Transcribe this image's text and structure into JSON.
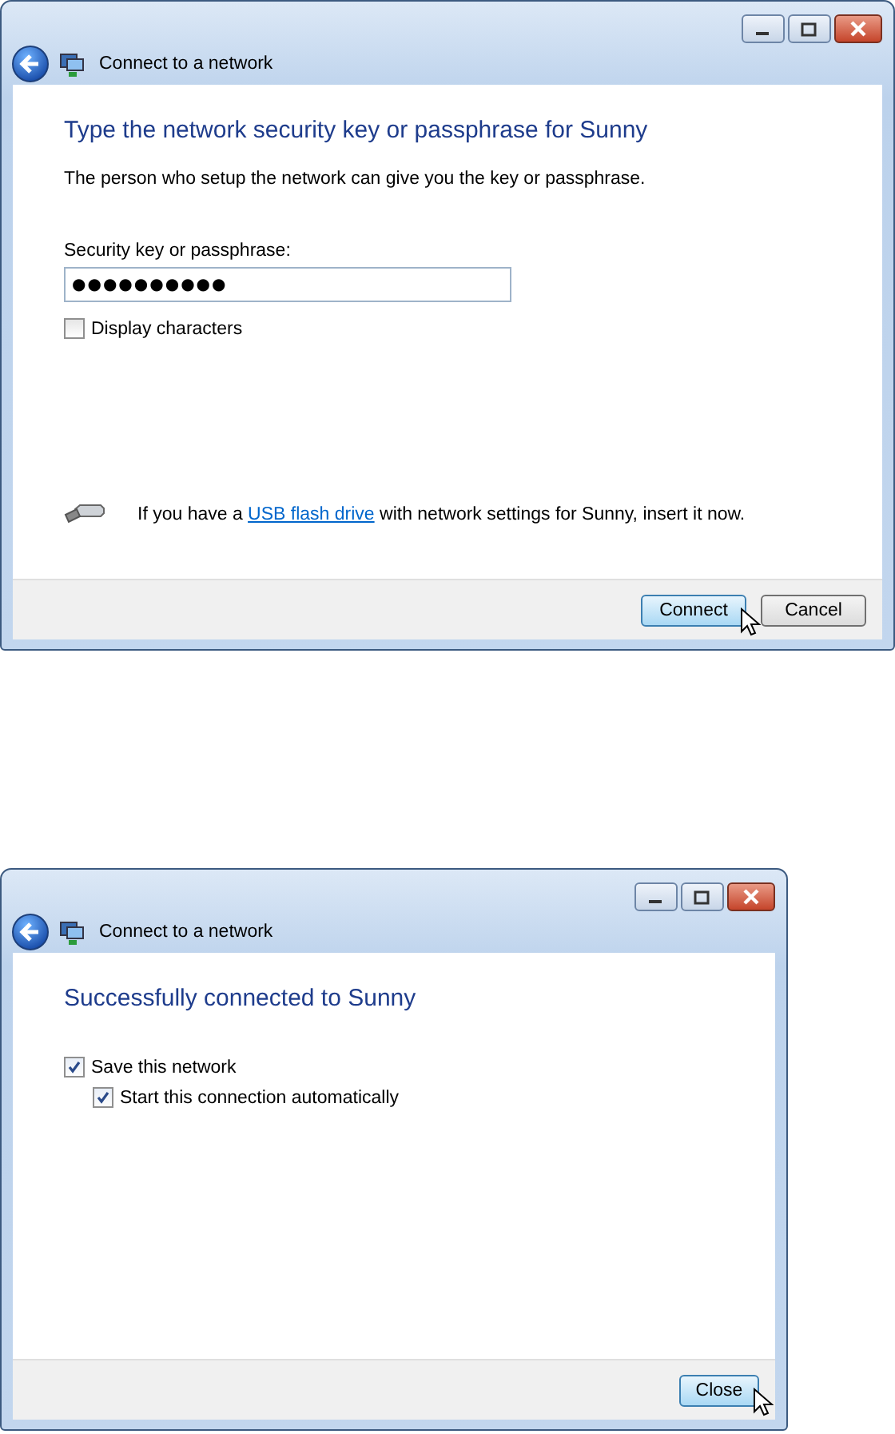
{
  "dialogs": [
    {
      "title": "Connect to a network",
      "heading": "Type the network security key or passphrase for Sunny",
      "description": "The person who setup the network can give you the key or passphrase.",
      "field": {
        "label": "Security key or passphrase:",
        "value": "●●●●●●●●●●"
      },
      "checkboxes": [
        {
          "label": "Display characters",
          "checked": false
        }
      ],
      "note": {
        "before": "If you have a ",
        "link": "USB flash drive",
        "after": " with network settings for Sunny, insert it now."
      },
      "buttons": [
        {
          "label": "Connect",
          "hovered": true
        },
        {
          "label": "Cancel",
          "hovered": false
        }
      ]
    },
    {
      "title": "Connect to a network",
      "heading": "Successfully connected to Sunny",
      "checkboxes": [
        {
          "label": "Save this network",
          "checked": true,
          "children": [
            {
              "label": "Start this connection automatically",
              "checked": true
            }
          ]
        }
      ],
      "buttons": [
        {
          "label": "Close",
          "hovered": true
        }
      ]
    }
  ]
}
